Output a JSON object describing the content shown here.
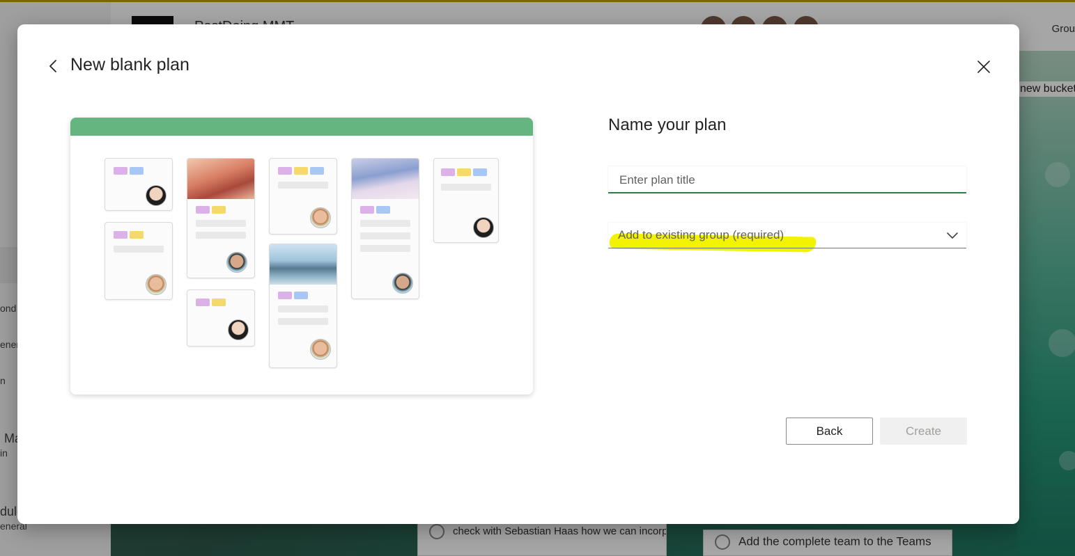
{
  "background": {
    "header": {
      "group_label": "Grou",
      "board_name": "PostDoing MMT"
    },
    "sidebar_fragments": [
      "ond",
      "ener",
      "n",
      "Ma",
      "in",
      "dule",
      "eneral"
    ],
    "right_panel_label": "new bucket",
    "cards": [
      {
        "text": "check with Sebastian Haas how we can incorp"
      },
      {
        "text": "Add the complete team to the Teams"
      }
    ]
  },
  "modal": {
    "title": "New blank plan",
    "name_heading": "Name your plan",
    "title_field": {
      "value": "",
      "placeholder": "Enter plan title"
    },
    "group_select": {
      "value": "Add to existing group (required)"
    },
    "buttons": {
      "back": "Back",
      "create": "Create"
    }
  },
  "colors": {
    "accent_green": "#2e7d46",
    "preview_bar": "#64b57f",
    "highlight": "#f3f300"
  }
}
